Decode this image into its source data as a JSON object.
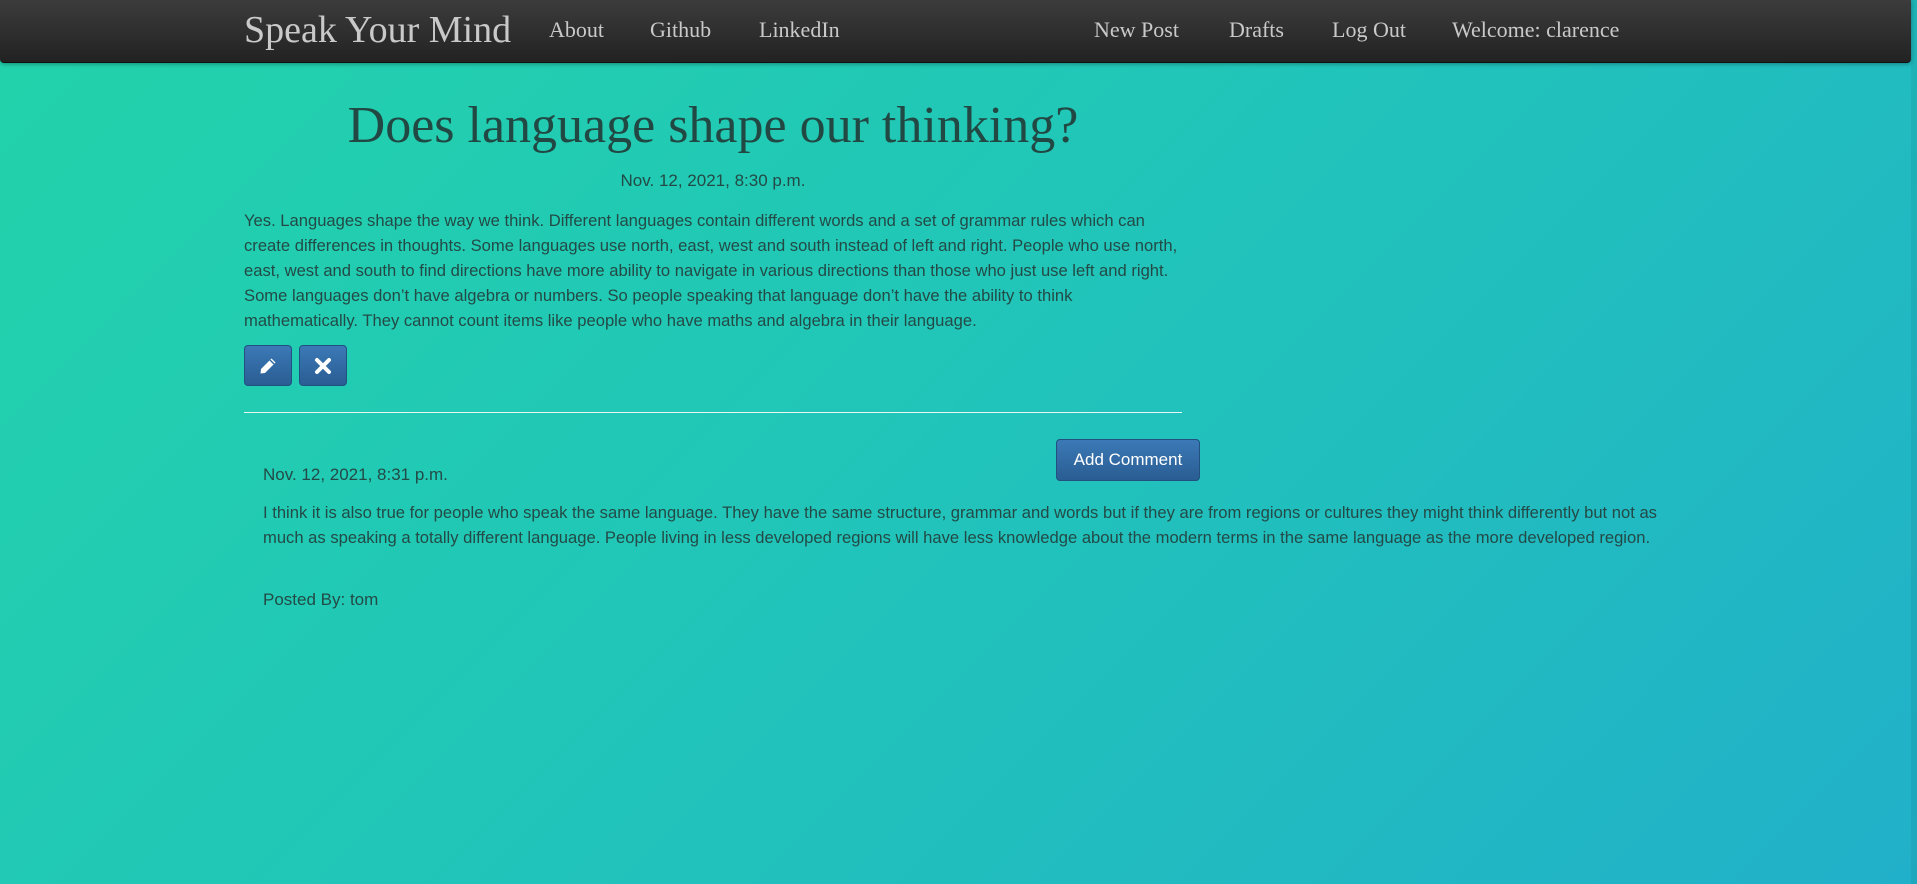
{
  "navbar": {
    "brand": "Speak Your Mind",
    "links_left": [
      "About",
      "Github",
      "LinkedIn"
    ],
    "links_right": [
      "New Post",
      "Drafts",
      "Log Out"
    ],
    "welcome": "Welcome: clarence"
  },
  "post": {
    "title": "Does language shape our thinking?",
    "date": "Nov. 12, 2021, 8:30 p.m.",
    "body": "Yes. Languages shape the way we think. Different languages contain different words and a set of grammar rules which can create differences in thoughts. Some languages use north, east, west and south instead of left and right. People who use north, east, west and south to find directions have more ability to navigate in various directions than those who just use left and right. Some languages don’t have algebra or numbers. So people speaking that language don’t have the ability to think mathematically. They cannot count items like people who have maths and algebra in their language.",
    "edit_icon": "pencil-icon",
    "delete_icon": "close-icon"
  },
  "comments_section": {
    "add_button_label": "Add Comment",
    "comments": [
      {
        "date": "Nov. 12, 2021, 8:31 p.m.",
        "body": "I think it is also true for people who speak the same language. They have the same structure, grammar and words but if they are from regions or cultures they might think differently but not as much as speaking a totally different language. People living in less developed regions will have less knowledge about the modern terms in the same language as the more developed region.",
        "posted_by_label": "Posted By:",
        "author": "tom"
      }
    ]
  },
  "colors": {
    "navbar": "#2b2b2b",
    "button": "#2f6aa6",
    "background_start": "#22d3aa",
    "background_end": "#21b0c9"
  }
}
